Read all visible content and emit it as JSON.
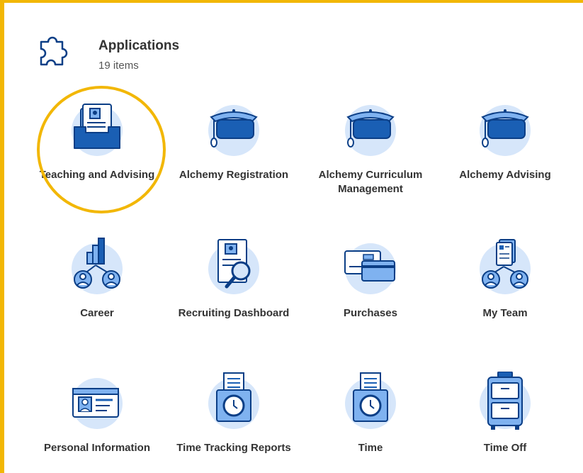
{
  "header": {
    "title": "Applications",
    "count": "19 items",
    "icon": "puzzle-icon"
  },
  "apps": [
    {
      "label": "Teaching and Advising",
      "icon": "inbox-tray-icon",
      "highlighted": true
    },
    {
      "label": "Alchemy Registration",
      "icon": "graduation-cap-icon"
    },
    {
      "label": "Alchemy Curriculum Management",
      "icon": "graduation-cap-icon"
    },
    {
      "label": "Alchemy Advising",
      "icon": "graduation-cap-icon"
    },
    {
      "label": "Career",
      "icon": "career-chart-icon"
    },
    {
      "label": "Recruiting Dashboard",
      "icon": "resume-search-icon"
    },
    {
      "label": "Purchases",
      "icon": "credit-card-icon"
    },
    {
      "label": "My Team",
      "icon": "team-icon"
    },
    {
      "label": "Personal Information",
      "icon": "id-card-icon"
    },
    {
      "label": "Time Tracking Reports",
      "icon": "time-report-icon"
    },
    {
      "label": "Time",
      "icon": "time-clock-icon"
    },
    {
      "label": "Time Off",
      "icon": "suitcase-icon"
    }
  ],
  "colors": {
    "highlight": "#f2b705",
    "icon_light": "#d6e6fa",
    "icon_mid": "#7fb2f0",
    "icon_dark": "#1a5fb4",
    "icon_stroke": "#0b3e86"
  }
}
